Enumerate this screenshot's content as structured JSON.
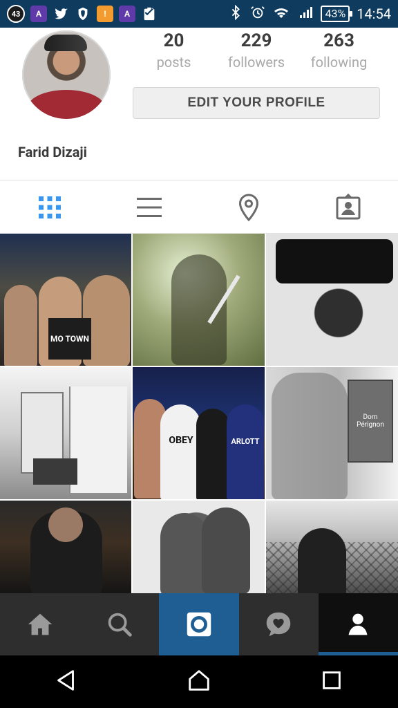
{
  "status_bar": {
    "notifications": [
      "43",
      "app-a",
      "twitter",
      "brave",
      "alert",
      "app-a-alert",
      "clipboard"
    ],
    "right": {
      "battery": "43%",
      "time": "14:54",
      "icons": [
        "bluetooth",
        "alarm",
        "wifi",
        "signal"
      ]
    },
    "color": "#0f3b5f"
  },
  "profile": {
    "stats": [
      {
        "value": "20",
        "label": "posts"
      },
      {
        "value": "229",
        "label": "followers"
      },
      {
        "value": "263",
        "label": "following"
      }
    ],
    "edit_button": "EDIT YOUR PROFILE",
    "full_name": "Farid Dizaji"
  },
  "tabs": [
    "grid",
    "list",
    "location",
    "tagged"
  ],
  "bottom_nav": [
    "home",
    "search",
    "camera",
    "activity",
    "profile"
  ],
  "system_nav": [
    "back",
    "home",
    "recent"
  ],
  "photo_overlay_text": {
    "p1_shirt": "MO TOWN",
    "p5_shirt_left": "OBEY",
    "p5_shirt_right": "ARLOTT",
    "p6_box": "Dom Pérignon"
  }
}
